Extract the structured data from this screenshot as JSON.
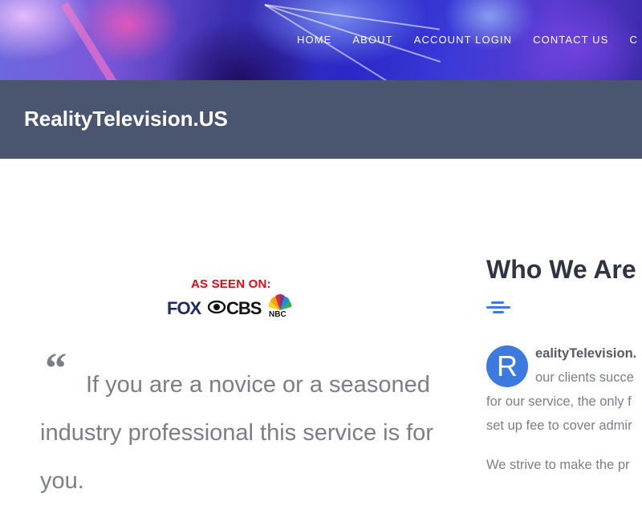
{
  "nav": {
    "items": [
      "HOME",
      "ABOUT",
      "ACCOUNT LOGIN",
      "CONTACT US",
      "C"
    ]
  },
  "site": {
    "title": "RealityTelevision.US"
  },
  "badge": {
    "heading": "AS SEEN ON:",
    "networks": [
      "FOX",
      "CBS",
      "NBC"
    ]
  },
  "quote": {
    "mark": "“",
    "text": "If you are a novice or a seasoned industry professional this service is for you."
  },
  "about": {
    "heading": "Who We Are",
    "dropcap": "R",
    "lead": "ealityTelevision.",
    "line2": "our clients succe",
    "line3": "for our service, the only f",
    "line4": "set up fee to cover admir",
    "line5": "We strive to make the pr"
  },
  "colors": {
    "band": "#4a5670",
    "accent": "#3d7ae0",
    "as_seen_on": "#e50914"
  }
}
